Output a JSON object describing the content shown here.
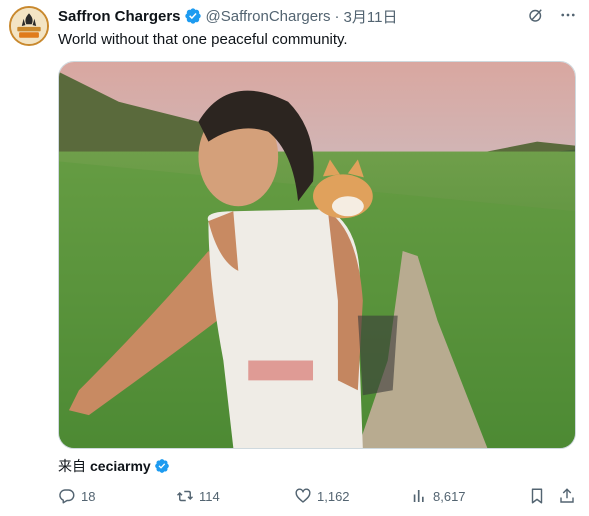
{
  "author": {
    "name": "Saffron Chargers",
    "handle": "@SaffronChargers",
    "separator": "·",
    "date": "3月11日",
    "avatar_icon": "saffron-chargers-logo",
    "verified_icon": "verified-badge-icon"
  },
  "header_icons": [
    "grok-icon",
    "more-icon"
  ],
  "post": {
    "text": "World without that one peaceful community."
  },
  "media": {
    "type": "video-thumbnail",
    "description_icon": "video-frame"
  },
  "source": {
    "prefix": "来自",
    "user": "ceciarmy"
  },
  "actions": {
    "replies": "18",
    "reposts": "114",
    "likes": "1,162",
    "views": "8,617"
  },
  "colors": {
    "verified": "#1d9bf0",
    "secondary_text": "#536471",
    "primary_text": "#0f1419"
  }
}
